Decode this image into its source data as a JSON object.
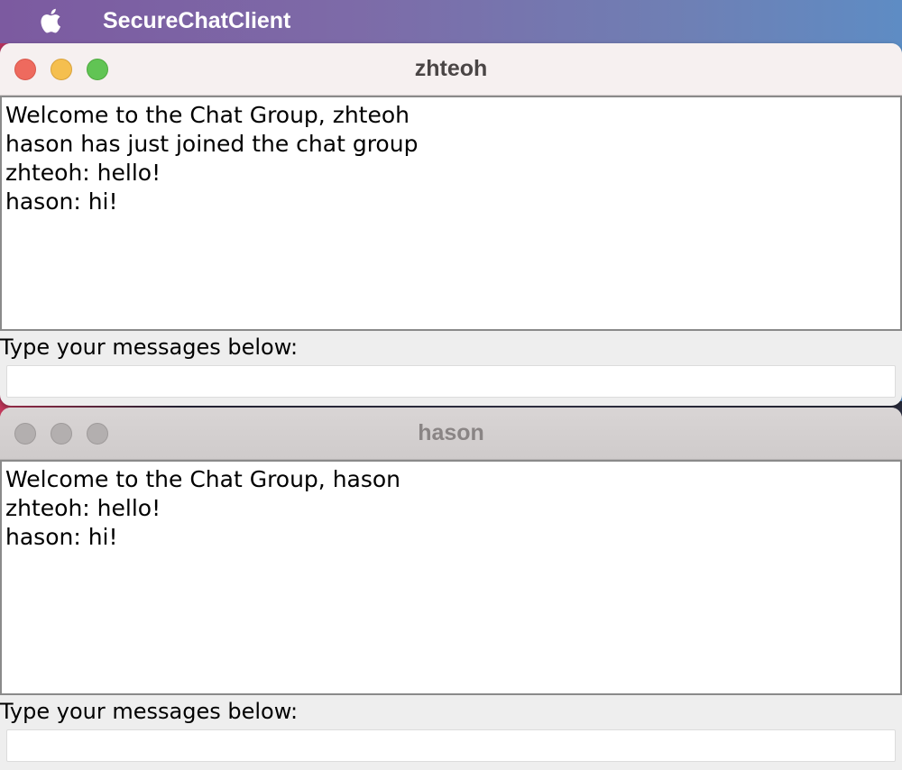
{
  "menubar": {
    "apple_icon": "apple-logo-icon",
    "app_name": "SecureChatClient"
  },
  "windows": [
    {
      "title": "zhteoh",
      "state": "active",
      "messages": [
        "Welcome to the Chat Group, zhteoh",
        "hason has just joined the chat group",
        "zhteoh: hello!",
        "hason: hi!"
      ],
      "prompt": "Type your messages below:",
      "input_value": ""
    },
    {
      "title": "hason",
      "state": "inactive",
      "messages": [
        "Welcome to the Chat Group, hason",
        "zhteoh: hello!",
        "hason: hi!"
      ],
      "prompt": "Type your messages below:",
      "input_value": ""
    }
  ],
  "colors": {
    "close": "#ee6a5e",
    "minimize": "#f5bf4f",
    "maximize": "#61c454",
    "inactive_control": "#b3afaf"
  }
}
